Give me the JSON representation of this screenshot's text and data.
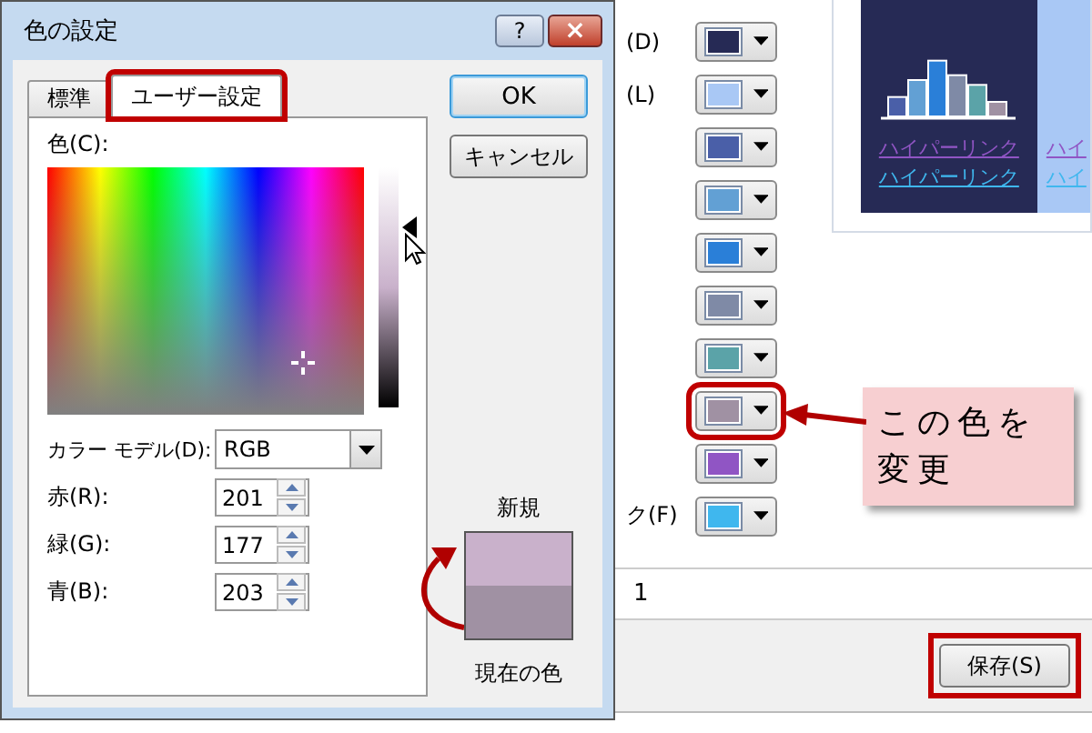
{
  "dialog": {
    "title": "色の設定",
    "help": "?",
    "close": "×",
    "tabs": [
      {
        "label": "標準",
        "selected": false
      },
      {
        "label": "ユーザー設定",
        "selected": true
      }
    ],
    "color_label": "色(C):",
    "luminance": {
      "level": 0.75
    },
    "model_label": "カラー モデル(D):",
    "model_value": "RGB",
    "channels": [
      {
        "label": "赤(R):",
        "value": "201"
      },
      {
        "label": "緑(G):",
        "value": "177"
      },
      {
        "label": "青(B):",
        "value": "203"
      }
    ],
    "ok": "OK",
    "cancel": "キャンセル",
    "new_label": "新規",
    "current_label": "現在の色"
  },
  "theme": {
    "swatches": [
      {
        "label": "(D)",
        "color": "#262a55",
        "highlighted": false
      },
      {
        "label": "(L)",
        "color": "#a9c8f5",
        "highlighted": false
      },
      {
        "color": "#4a5fa8",
        "highlighted": false
      },
      {
        "color": "#62a0d4",
        "highlighted": false
      },
      {
        "color": "#2a7fd8",
        "highlighted": false
      },
      {
        "color": "#7f8aa6",
        "highlighted": false
      },
      {
        "color": "#5ba3a8",
        "highlighted": false
      },
      {
        "color": "#a091a3",
        "highlighted": true
      },
      {
        "color": "#9055c4",
        "highlighted": false
      },
      {
        "label": "ク(F)",
        "color": "#3fb7ee",
        "highlighted": false
      }
    ],
    "preview_links": [
      "ハイパーリンク",
      "ハイパーリンク"
    ],
    "preview_links_light": [
      "ハイ",
      "ハイ"
    ],
    "name_value": "1",
    "save": {
      "label": "保存(S)",
      "highlighted": true
    }
  },
  "callout": {
    "lines": [
      "この色を",
      "変更"
    ]
  }
}
